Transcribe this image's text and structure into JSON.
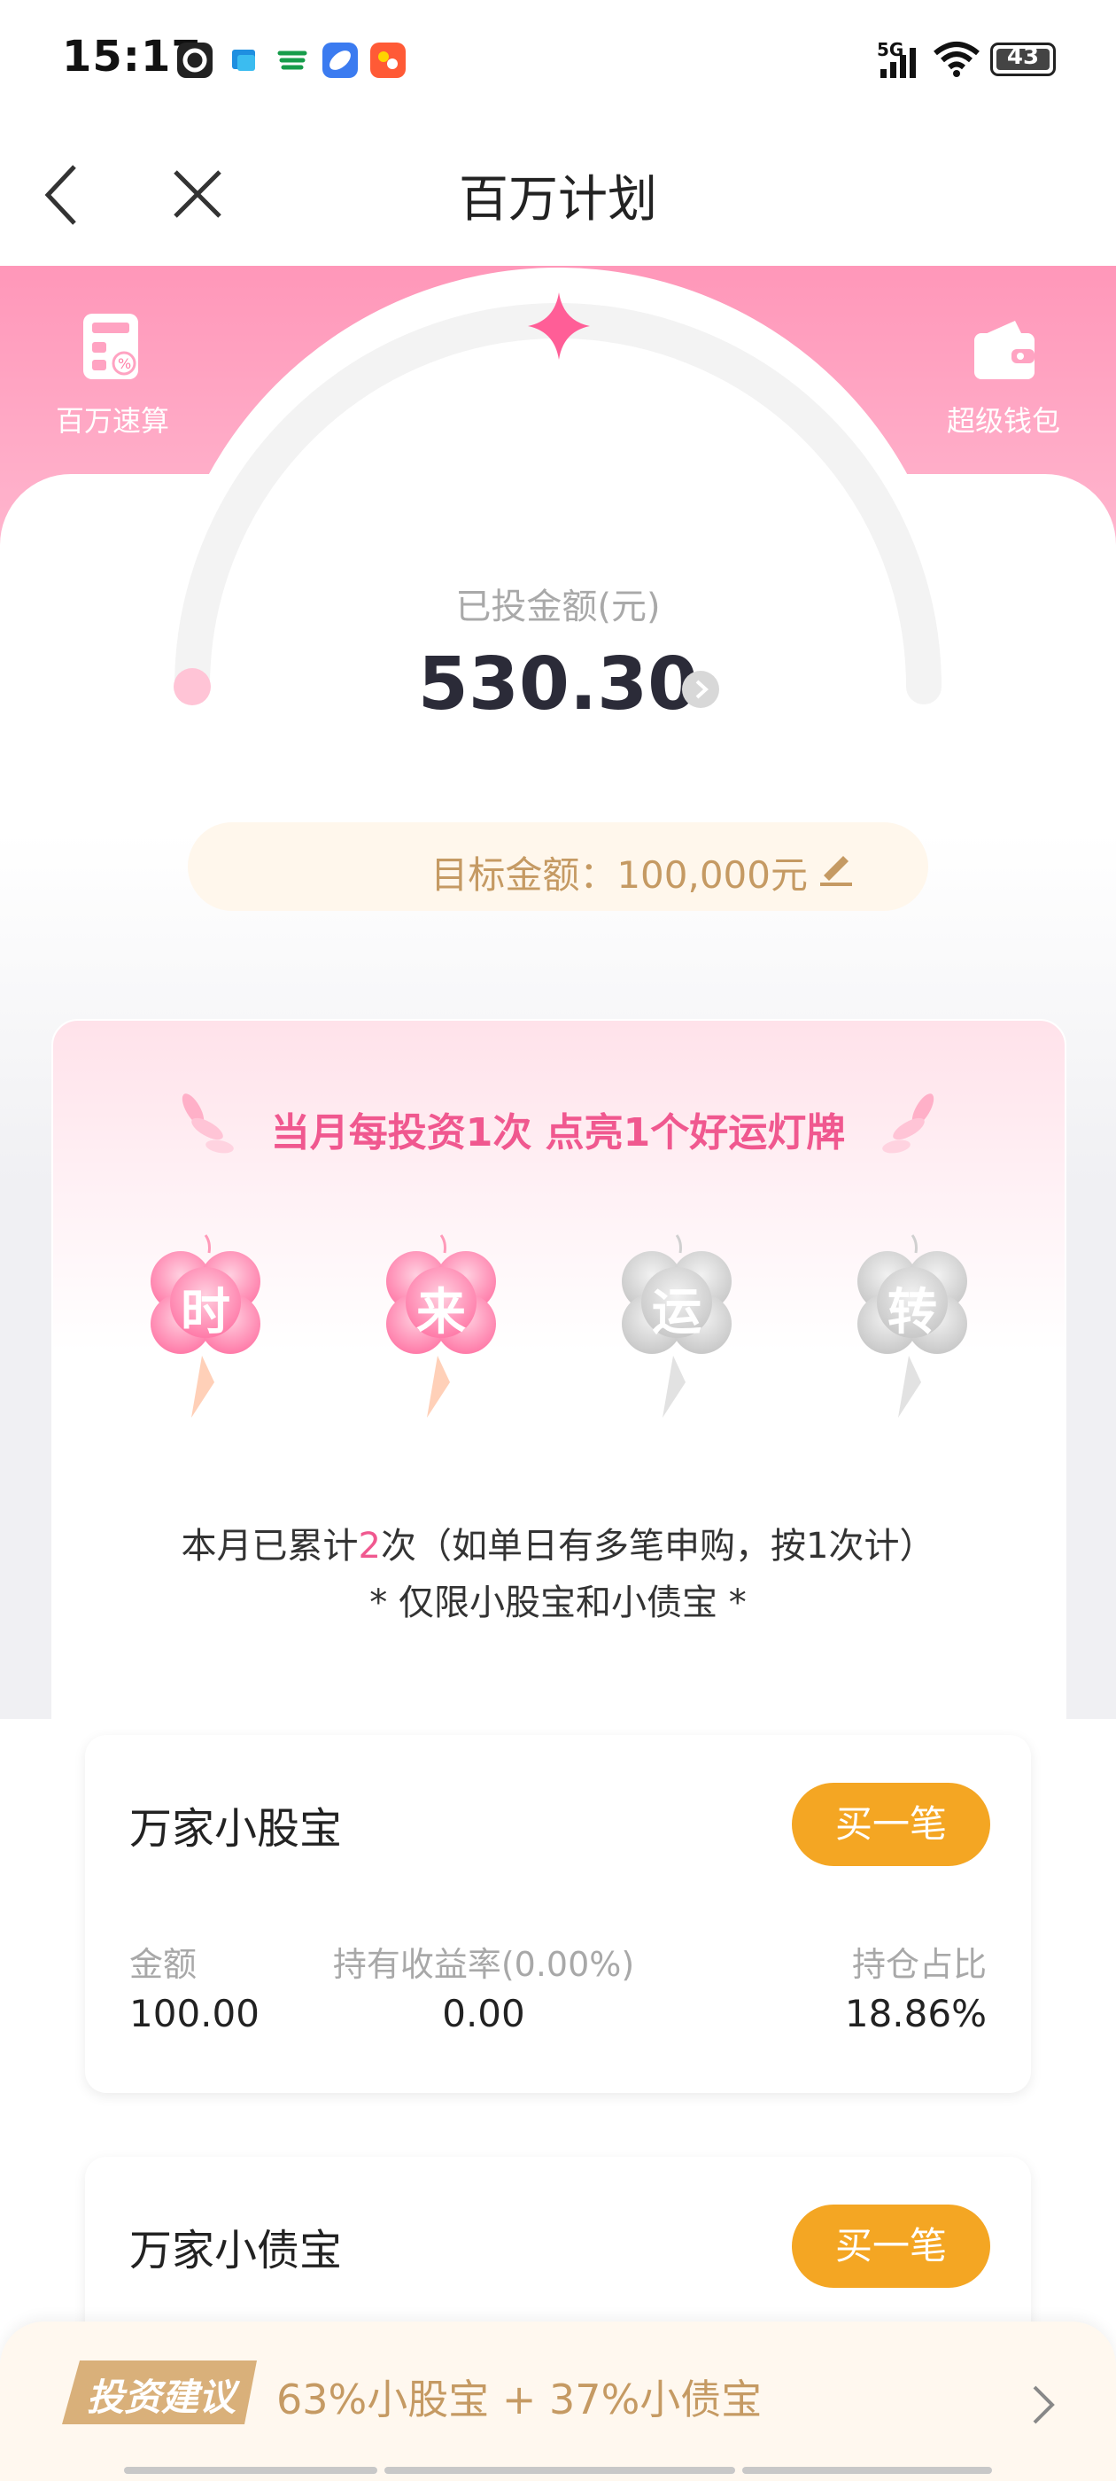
{
  "status_bar": {
    "time": "15:17",
    "network": "5G",
    "battery": "43"
  },
  "nav": {
    "title": "百万计划"
  },
  "header": {
    "left_tool_label": "百万速算",
    "right_tool_label": "超级钱包"
  },
  "invested": {
    "label": "已投金额(元)",
    "value": "530.30"
  },
  "target": {
    "text": "目标金额：100,000元"
  },
  "lucky": {
    "title": "当月每投资1次 点亮1个好运灯牌",
    "clovers": [
      {
        "char": "时",
        "lit": true
      },
      {
        "char": "来",
        "lit": true
      },
      {
        "char": "运",
        "lit": false
      },
      {
        "char": "转",
        "lit": false
      }
    ],
    "count_prefix": "本月已累计",
    "count_value": "2",
    "count_suffix": "次（如单日有多笔申购，按1次计）",
    "limit_note": "* 仅限小股宝和小债宝 *"
  },
  "funds": [
    {
      "name": "万家小股宝",
      "buy_label": "买一笔",
      "amount_label": "金额",
      "amount_value": "100.00",
      "return_label": "持有收益率(0.00%)",
      "return_value": "0.00",
      "ratio_label": "持仓占比",
      "ratio_value": "18.86%"
    },
    {
      "name": "万家小债宝",
      "buy_label": "买一笔"
    }
  ],
  "advice": {
    "tag": "投资建议",
    "text": "63%小股宝 + 37%小债宝"
  },
  "colors": {
    "brand_pink": "#f0588f",
    "buy_orange": "#f4a623",
    "gold_text": "#c59a63"
  }
}
